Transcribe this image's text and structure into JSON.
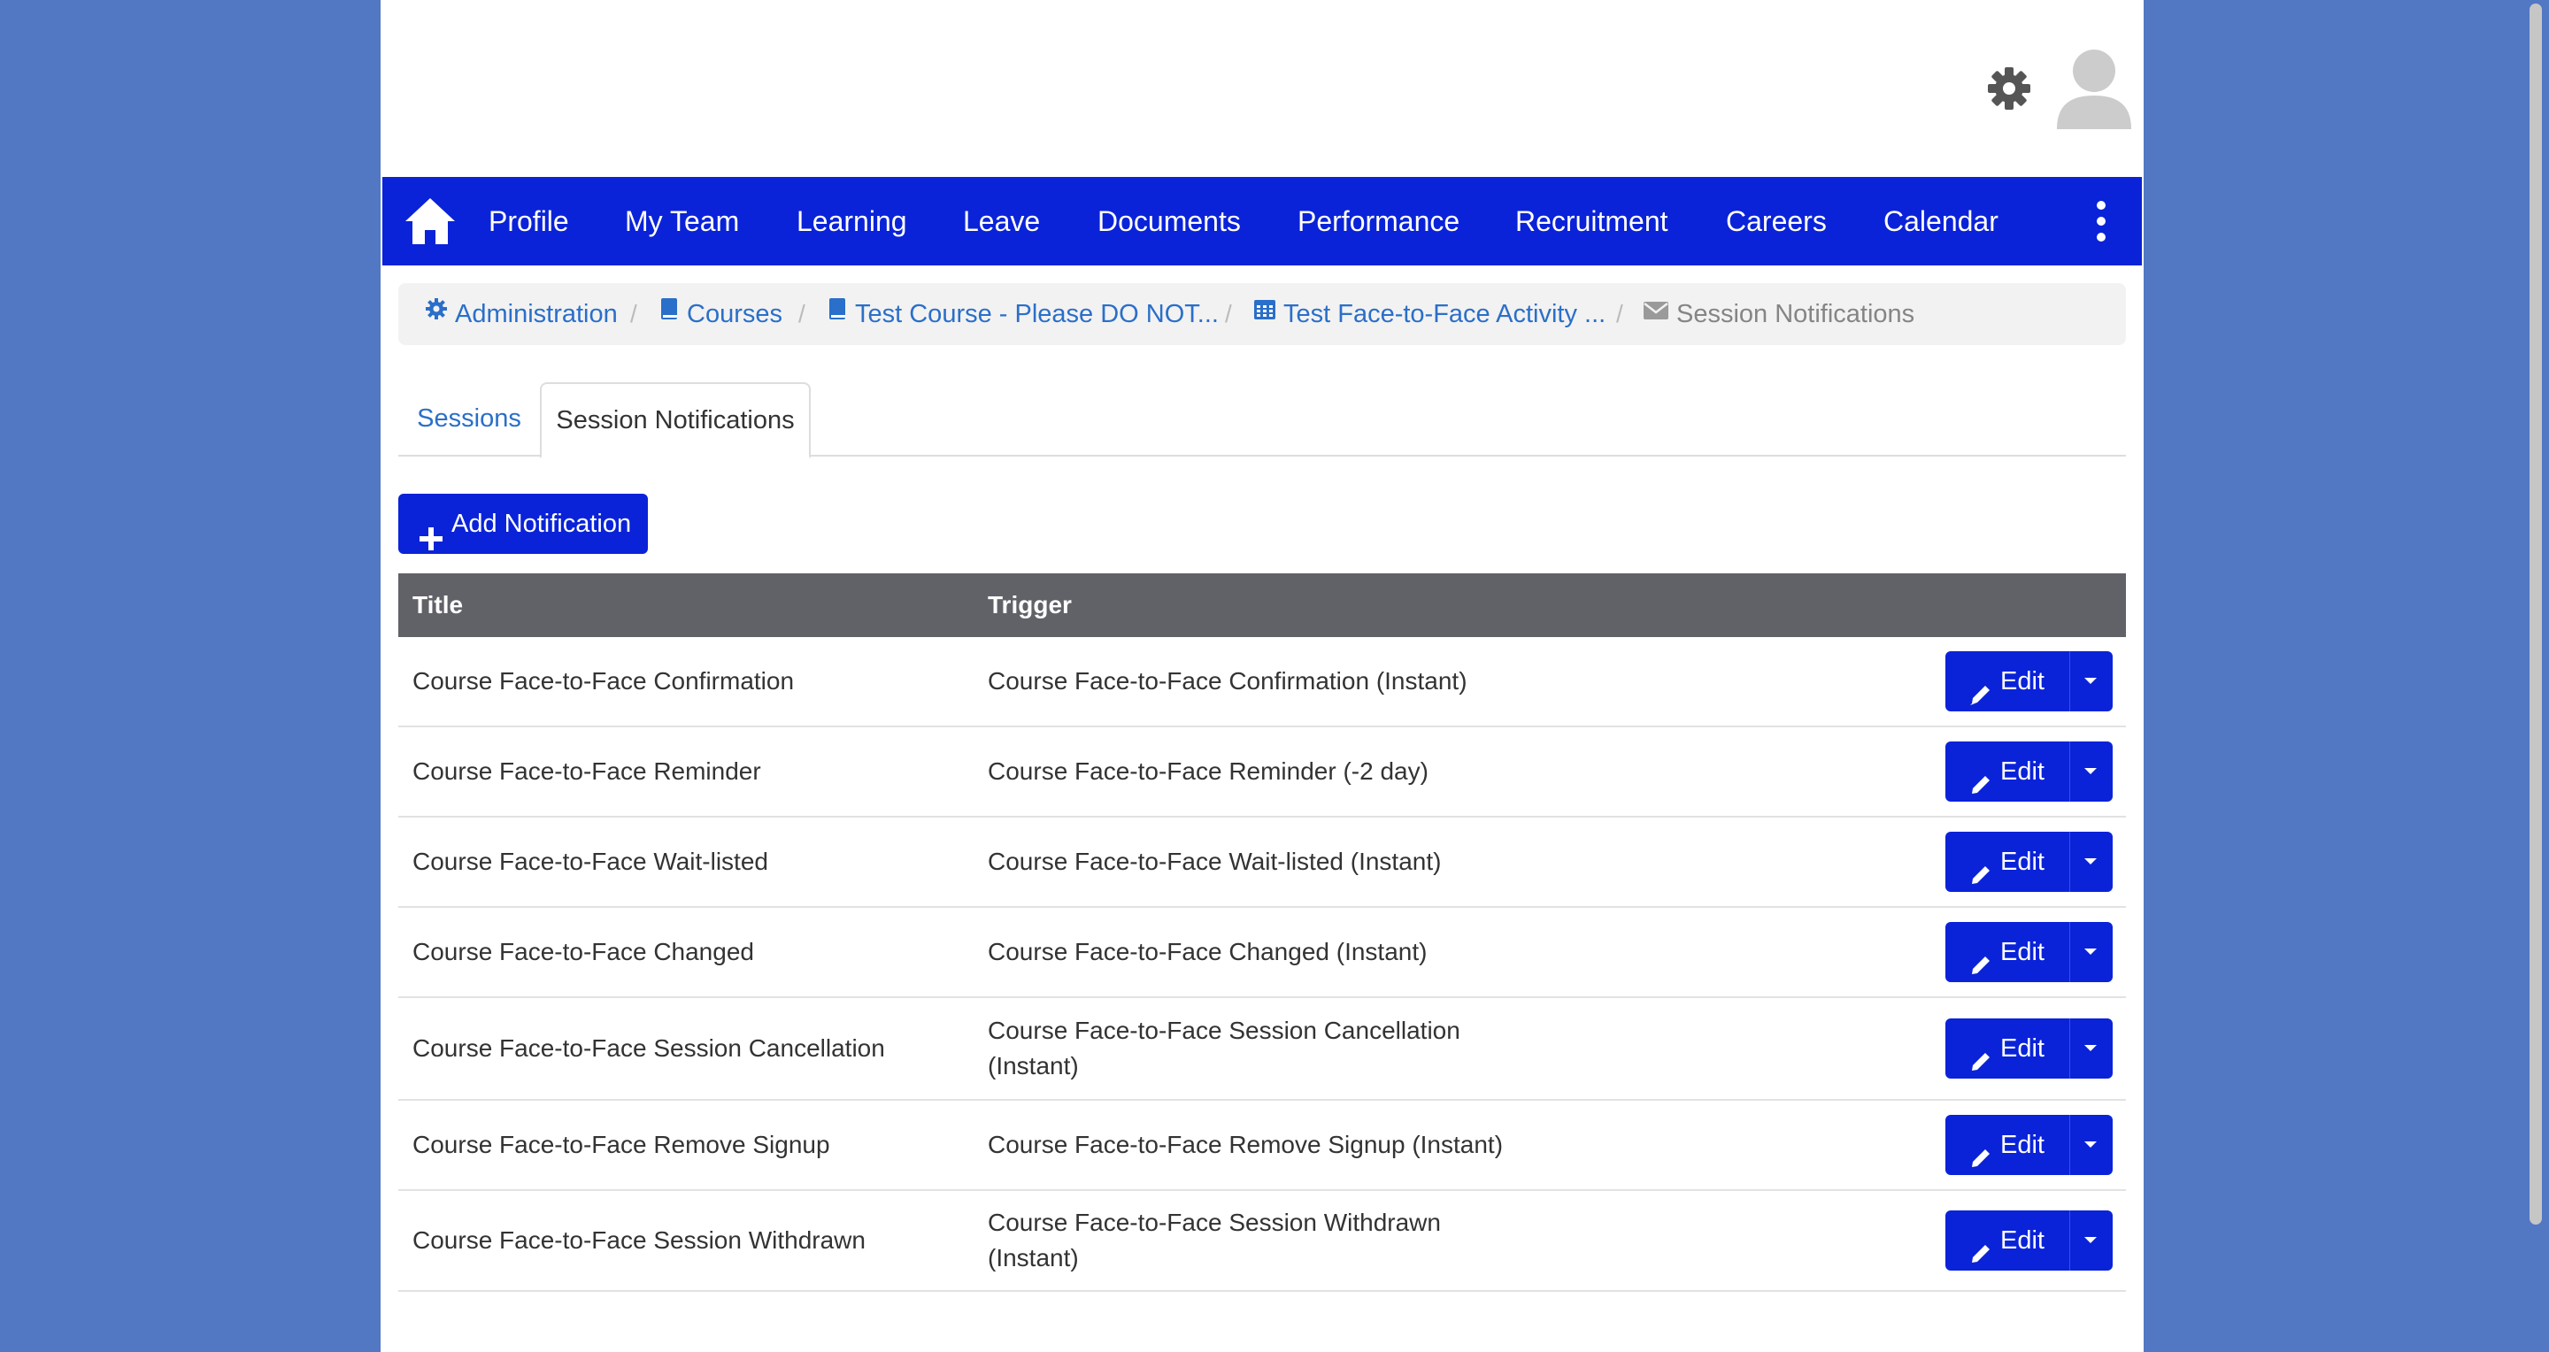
{
  "header": {
    "settings_icon": "gear-icon",
    "avatar_icon": "user-avatar-icon"
  },
  "nav": {
    "home_icon": "home-icon",
    "items": [
      "Profile",
      "My Team",
      "Learning",
      "Leave",
      "Documents",
      "Performance",
      "Recruitment",
      "Careers",
      "Calendar"
    ],
    "more_icon": "kebab-menu-icon"
  },
  "breadcrumb": {
    "items": [
      {
        "label": "Administration",
        "icon": "gear-icon"
      },
      {
        "label": "Courses",
        "icon": "book-icon"
      },
      {
        "label": "Test Course - Please DO NOT...",
        "icon": "book-icon"
      },
      {
        "label": "Test Face-to-Face Activity ...",
        "icon": "calendar-icon"
      },
      {
        "label": "Session Notifications",
        "icon": "envelope-icon"
      }
    ]
  },
  "tabs": [
    {
      "label": "Sessions"
    },
    {
      "label": "Session Notifications"
    }
  ],
  "add_button_label": "Add Notification",
  "table": {
    "headers": {
      "title": "Title",
      "trigger": "Trigger"
    },
    "edit_label": "Edit",
    "rows": [
      {
        "title": "Course Face-to-Face Confirmation",
        "trigger": "Course Face-to-Face Confirmation (Instant)"
      },
      {
        "title": "Course Face-to-Face Reminder",
        "trigger": "Course Face-to-Face Reminder (-2 day)"
      },
      {
        "title": "Course Face-to-Face Wait-listed",
        "trigger": "Course Face-to-Face Wait-listed (Instant)"
      },
      {
        "title": "Course Face-to-Face Changed",
        "trigger": "Course Face-to-Face Changed (Instant)"
      },
      {
        "title": "Course Face-to-Face Session Cancellation",
        "trigger": "Course Face-to-Face Session Cancellation (Instant)"
      },
      {
        "title": "Course Face-to-Face Remove Signup",
        "trigger": "Course Face-to-Face Remove Signup (Instant)"
      },
      {
        "title": "Course Face-to-Face Session Withdrawn",
        "trigger": "Course Face-to-Face Session Withdrawn (Instant)"
      }
    ]
  },
  "colors": {
    "background": "#5278c4",
    "nav": "#0a23d8",
    "primary_button": "#0a23d8",
    "table_header": "#616268",
    "link": "#2a6fc9"
  }
}
